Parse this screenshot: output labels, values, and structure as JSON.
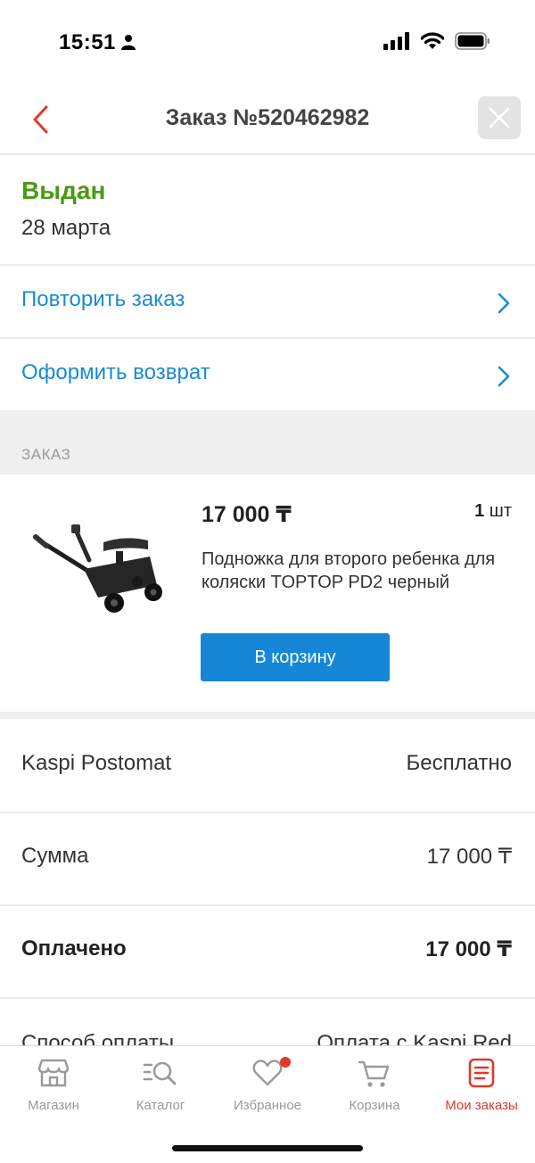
{
  "status_bar": {
    "time": "15:51"
  },
  "nav": {
    "title": "Заказ №520462982"
  },
  "order_status": {
    "title": "Выдан",
    "date": "28 марта"
  },
  "actions": [
    {
      "label": "Повторить заказ"
    },
    {
      "label": "Оформить возврат"
    }
  ],
  "section": {
    "label": "ЗАКАЗ"
  },
  "item": {
    "price": "17 000 ₸",
    "qty_number": "1",
    "qty_unit": "шт",
    "name": "Подножка для второго ребенка для коляски TOPTOP PD2 черный",
    "cart_button": "В корзину"
  },
  "summary": [
    {
      "label": "Kaspi Postomat",
      "value": "Бесплатно"
    },
    {
      "label": "Сумма",
      "value": "17 000 ₸"
    },
    {
      "label": "Оплачено",
      "value": "17 000 ₸"
    },
    {
      "label": "Способ оплаты",
      "value": "Оплата с Kaspi Red"
    }
  ],
  "tabs": [
    {
      "label": "Магазин",
      "icon": "store-icon"
    },
    {
      "label": "Каталог",
      "icon": "catalog-search-icon"
    },
    {
      "label": "Избранное",
      "icon": "heart-icon"
    },
    {
      "label": "Корзина",
      "icon": "cart-icon"
    },
    {
      "label": "Мои заказы",
      "icon": "orders-icon"
    }
  ],
  "colors": {
    "accent_red": "#e0392b",
    "link_blue": "#1a8bd3",
    "status_green": "#4a9a12",
    "button_blue": "#1587d6"
  }
}
